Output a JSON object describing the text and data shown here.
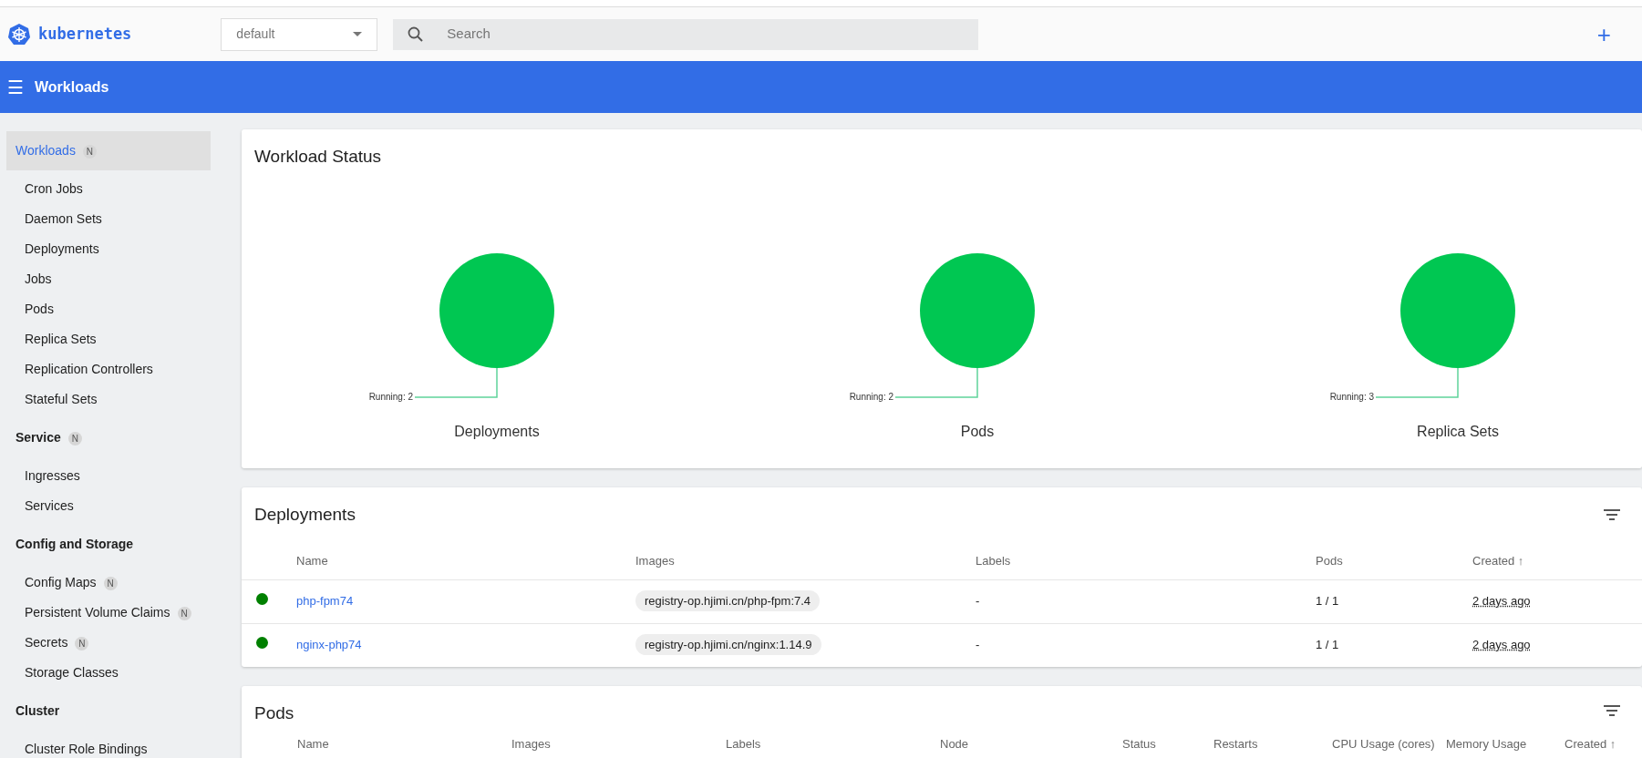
{
  "header": {
    "logo": "kubernetes",
    "namespace": "default",
    "search": {
      "placeholder": "Search"
    },
    "add": "+"
  },
  "toolbar": {
    "menu": "☰",
    "title": "Workloads"
  },
  "sidebar": {
    "sections": [
      {
        "label": "Workloads",
        "badge": "N",
        "selected": true,
        "items": [
          {
            "label": "Cron Jobs"
          },
          {
            "label": "Daemon Sets"
          },
          {
            "label": "Deployments"
          },
          {
            "label": "Jobs"
          },
          {
            "label": "Pods"
          },
          {
            "label": "Replica Sets"
          },
          {
            "label": "Replication Controllers"
          },
          {
            "label": "Stateful Sets"
          }
        ]
      },
      {
        "label": "Service",
        "badge": "N",
        "selected": false,
        "items": [
          {
            "label": "Ingresses"
          },
          {
            "label": "Services"
          }
        ]
      },
      {
        "label": "Config and Storage",
        "selected": false,
        "items": [
          {
            "label": "Config Maps",
            "badge": "N"
          },
          {
            "label": "Persistent Volume Claims",
            "badge": "N"
          },
          {
            "label": "Secrets",
            "badge": "N"
          },
          {
            "label": "Storage Classes"
          }
        ]
      },
      {
        "label": "Cluster",
        "selected": false,
        "items": [
          {
            "label": "Cluster Role Bindings"
          }
        ]
      }
    ]
  },
  "workload_status": {
    "title": "Workload Status",
    "charts": [
      {
        "title": "Deployments",
        "label": "Running: 2",
        "color": "#00c752"
      },
      {
        "title": "Pods",
        "label": "Running: 2",
        "color": "#00c752"
      },
      {
        "title": "Replica Sets",
        "label": "Running: 3",
        "color": "#00c752"
      }
    ]
  },
  "deployments": {
    "title": "Deployments",
    "columns": [
      "Name",
      "Images",
      "Labels",
      "Pods",
      "Created ↑"
    ],
    "rows": [
      {
        "color": "#008000",
        "name": "php-fpm74",
        "image": "registry-op.hjimi.cn/php-fpm:7.4",
        "labels": "-",
        "pods": "1 / 1",
        "created": "2 days ago"
      },
      {
        "color": "#008000",
        "name": "nginx-php74",
        "image": "registry-op.hjimi.cn/nginx:1.14.9",
        "labels": "-",
        "pods": "1 / 1",
        "created": "2 days ago"
      }
    ]
  },
  "pods": {
    "title": "Pods",
    "columns": [
      "Name",
      "Images",
      "Labels",
      "Node",
      "Status",
      "Restarts",
      "CPU Usage (cores)",
      "Memory Usage",
      "Created ↑"
    ]
  }
}
